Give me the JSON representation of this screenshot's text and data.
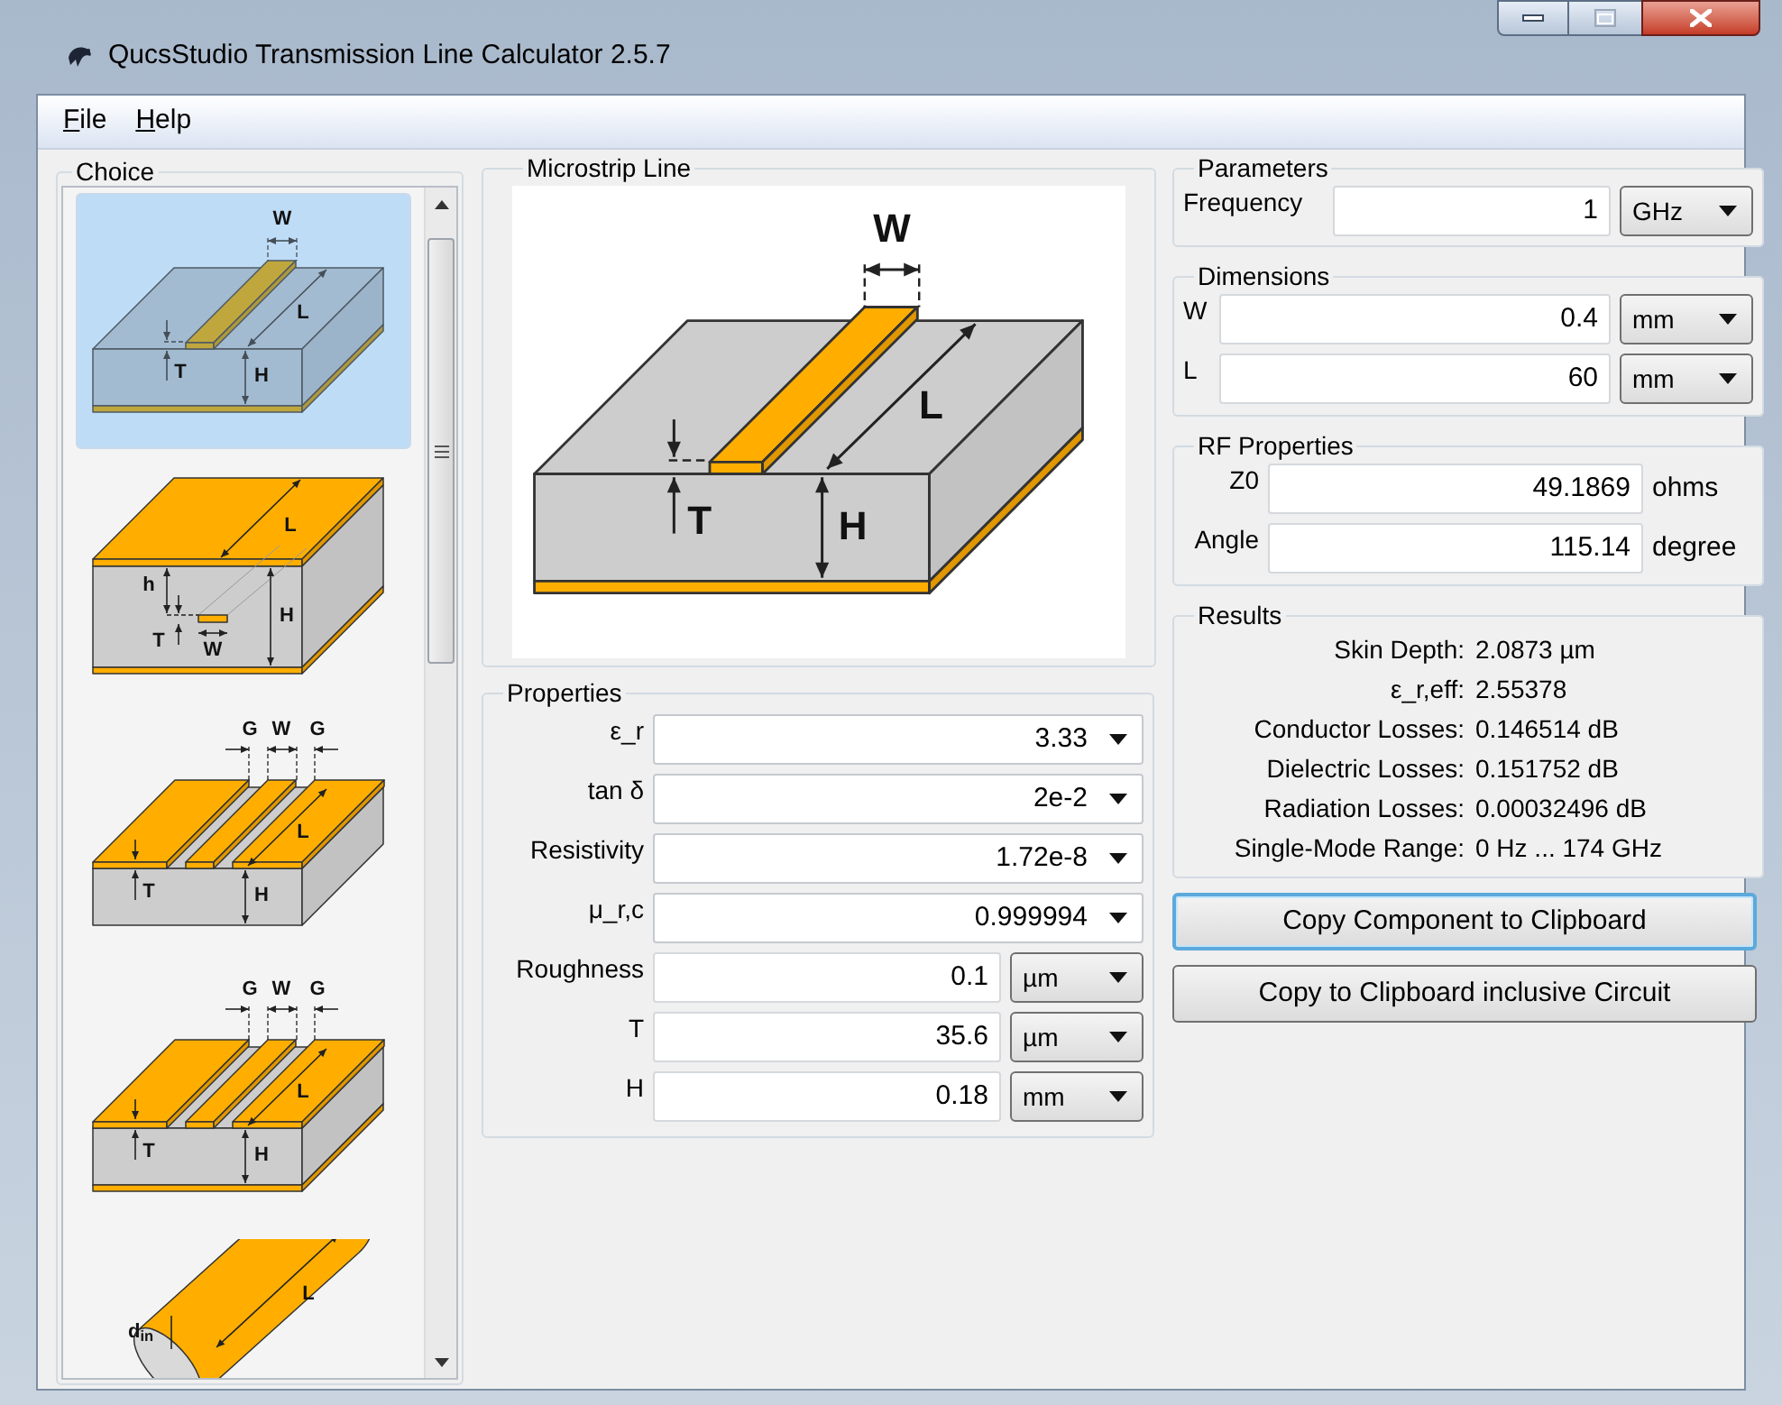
{
  "window": {
    "title": "QucsStudio Transmission Line Calculator 2.5.7"
  },
  "menu": [
    {
      "label": "File"
    },
    {
      "label": "Help"
    }
  ],
  "choice": {
    "title": "Choice",
    "items": [
      {
        "kind": "microstrip",
        "selected": true,
        "labels": [
          "W",
          "L",
          "T",
          "H"
        ]
      },
      {
        "kind": "stripline",
        "selected": false,
        "labels": [
          "L",
          "h",
          "T",
          "W",
          "H"
        ]
      },
      {
        "kind": "coplanar",
        "selected": false,
        "labels": [
          "G",
          "W",
          "G",
          "L",
          "T",
          "H"
        ]
      },
      {
        "kind": "grounded_coplanar",
        "selected": false,
        "labels": [
          "G",
          "W",
          "G",
          "L",
          "T",
          "H"
        ]
      },
      {
        "kind": "coax",
        "selected": false,
        "labels": [
          "d$_{in}$",
          "L"
        ]
      }
    ]
  },
  "diagram": {
    "title": "Microstrip Line",
    "kind": "microstrip",
    "labels": [
      "W",
      "L",
      "T",
      "H"
    ]
  },
  "properties": {
    "title": "Properties",
    "rows": [
      {
        "label": "ε_r",
        "value": "3.33",
        "kind": "combo"
      },
      {
        "label": "tan δ",
        "value": "2e-2",
        "kind": "combo"
      },
      {
        "label": "Resistivity",
        "value": "1.72e-8",
        "kind": "combo"
      },
      {
        "label": "μ_r,c",
        "value": "0.999994",
        "kind": "combo"
      },
      {
        "label": "Roughness",
        "value": "0.1",
        "unit": "µm",
        "kind": "unit"
      },
      {
        "label": "T",
        "value": "35.6",
        "unit": "µm",
        "kind": "unit"
      },
      {
        "label": "H",
        "value": "0.18",
        "unit": "mm",
        "kind": "unit"
      }
    ]
  },
  "parameters": {
    "title": "Parameters",
    "rows": [
      {
        "label": "Frequency",
        "value": "1",
        "unit": "GHz",
        "kind": "unit"
      }
    ]
  },
  "dimensions": {
    "title": "Dimensions",
    "rows": [
      {
        "label": "W",
        "value": "0.4",
        "unit": "mm",
        "kind": "unit"
      },
      {
        "label": "L",
        "value": "60",
        "unit": "mm",
        "kind": "unit"
      }
    ]
  },
  "rf_properties": {
    "title": "RF Properties",
    "rows": [
      {
        "label": "Z0",
        "value": "49.1869",
        "unit": "ohms",
        "kind": "suffix"
      },
      {
        "label": "Angle",
        "value": "115.14",
        "unit": "degree",
        "kind": "suffix"
      }
    ]
  },
  "results": {
    "title": "Results",
    "rows": [
      {
        "label": "Skin Depth:",
        "value": "2.0873 µm"
      },
      {
        "label": "ε_r,eff:",
        "value": "2.55378"
      },
      {
        "label": "Conductor Losses:",
        "value": "0.146514 dB"
      },
      {
        "label": "Dielectric Losses:",
        "value": "0.151752 dB"
      },
      {
        "label": "Radiation Losses:",
        "value": "0.00032496 dB"
      },
      {
        "label": "Single-Mode Range:",
        "value": "0 Hz ... 174 GHz"
      }
    ]
  },
  "buttons": [
    {
      "label": "Copy Component to Clipboard",
      "focused": true
    },
    {
      "label": "Copy to Clipboard inclusive Circuit",
      "focused": false
    }
  ]
}
